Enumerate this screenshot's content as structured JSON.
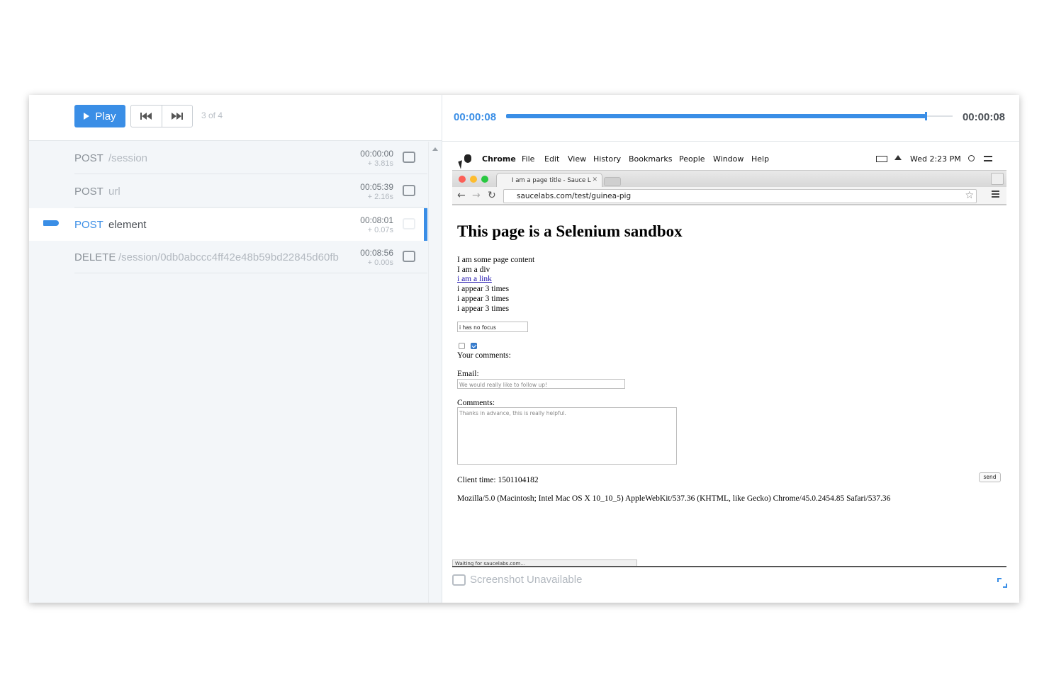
{
  "toolbar": {
    "play_label": "Play",
    "counter": "3 of 4"
  },
  "commands": [
    {
      "method": "POST",
      "path": "/session",
      "time": "00:00:00",
      "delta": "+ 3.81s"
    },
    {
      "method": "POST",
      "path": "url",
      "time": "00:05:39",
      "delta": "+ 2.16s"
    },
    {
      "method": "POST",
      "path": "element",
      "time": "00:08:01",
      "delta": "+ 0.07s",
      "selected": true
    },
    {
      "method": "DELETE",
      "path": "/session/0db0abccc4ff42e48b59bd22845d60fb",
      "time": "00:08:56",
      "delta": "+ 0.00s"
    }
  ],
  "timeline": {
    "start": "00:00:08",
    "end": "00:00:08",
    "progress": 0.94
  },
  "mac_menu": {
    "app": "Chrome",
    "items": [
      "File",
      "Edit",
      "View",
      "History",
      "Bookmarks",
      "People",
      "Window",
      "Help"
    ],
    "clock": "Wed 2:23 PM"
  },
  "browser": {
    "tab_title": "I am a page title - Sauce L",
    "url": "saucelabs.com/test/guinea-pig",
    "status": "Waiting for saucelabs.com..."
  },
  "page": {
    "heading": "This page is a Selenium sandbox",
    "content": "I am some page content",
    "div": "I am a div",
    "link": "i am a link",
    "appear": [
      "i appear 3 times",
      "i appear 3 times",
      "i appear 3 times"
    ],
    "focus_input_value": "i has no focus",
    "comments_label": "Your comments:",
    "email_label": "Email:",
    "email_placeholder": "We would really like to follow up!",
    "comments_field_label": "Comments:",
    "comments_placeholder": "Thanks in advance, this is really helpful.",
    "client_time": "Client time: 1501104182",
    "send_label": "send",
    "user_agent": "Mozilla/5.0 (Macintosh; Intel Mac OS X 10_10_5) AppleWebKit/537.36 (KHTML, like Gecko) Chrome/45.0.2454.85 Safari/537.36"
  },
  "footer": {
    "unavailable": "Screenshot Unavailable"
  },
  "colors": {
    "accent": "#3a8ee6",
    "panel_bg": "#f3f6f9"
  }
}
